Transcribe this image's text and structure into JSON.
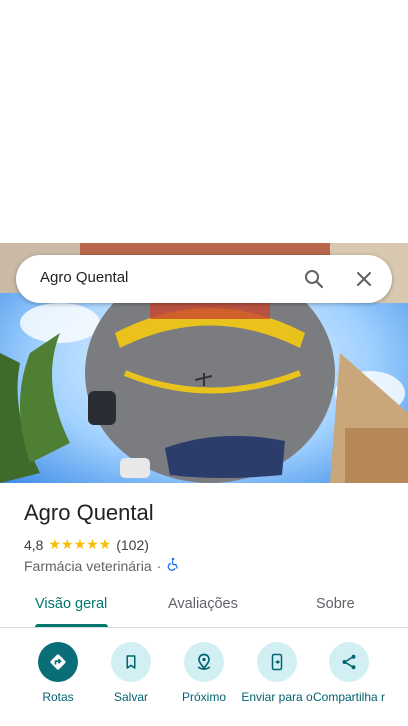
{
  "search": {
    "query": "Agro Quental"
  },
  "place": {
    "name": "Agro Quental",
    "rating": "4,8",
    "stars": "★★★★★",
    "reviews": "(102)",
    "category": "Farmácia veterinária",
    "separator": "·"
  },
  "tabs": [
    {
      "label": "Visão geral",
      "active": true
    },
    {
      "label": "Avaliações",
      "active": false
    },
    {
      "label": "Sobre",
      "active": false
    }
  ],
  "actions": [
    {
      "label": "Rotas",
      "icon": "directions-icon"
    },
    {
      "label": "Salvar",
      "icon": "bookmark-icon"
    },
    {
      "label": "Próximo",
      "icon": "nearby-icon"
    },
    {
      "label": "Enviar para o",
      "icon": "send-to-phone-icon"
    },
    {
      "label": "Compartilha r",
      "icon": "share-icon"
    }
  ],
  "colors": {
    "accent": "#00766c",
    "star": "#fbbc04",
    "accessible": "#1a73e8"
  }
}
